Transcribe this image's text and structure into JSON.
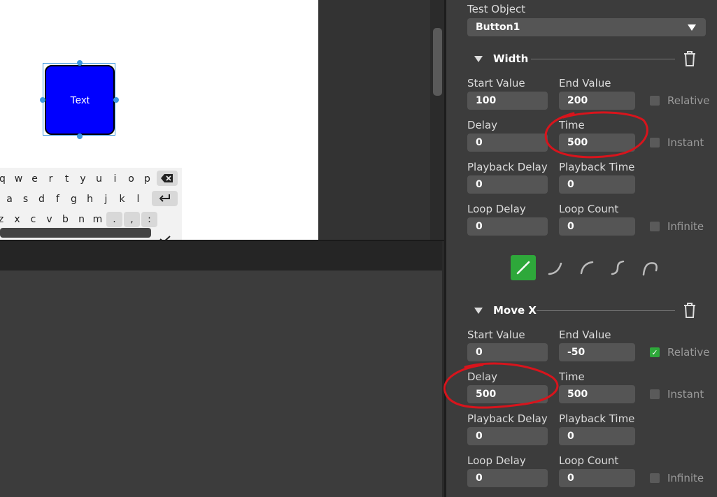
{
  "canvas": {
    "button_text": "Text",
    "keyboard": {
      "row1": [
        "q",
        "w",
        "e",
        "r",
        "t",
        "y",
        "u",
        "i",
        "o",
        "p"
      ],
      "row2": [
        "a",
        "s",
        "d",
        "f",
        "g",
        "h",
        "j",
        "k",
        "l"
      ],
      "row3": [
        "z",
        "x",
        "c",
        "v",
        "b",
        "n",
        "m",
        ".",
        ",",
        ":"
      ]
    }
  },
  "panel": {
    "test_object_label": "Test Object",
    "test_object_value": "Button1",
    "sections": [
      {
        "title": "Width",
        "start_value_label": "Start Value",
        "start_value": "100",
        "end_value_label": "End Value",
        "end_value": "200",
        "relative_label": "Relative",
        "relative_checked": false,
        "delay_label": "Delay",
        "delay": "0",
        "time_label": "Time",
        "time": "500",
        "instant_label": "Instant",
        "instant_checked": false,
        "playback_delay_label": "Playback Delay",
        "playback_delay": "0",
        "playback_time_label": "Playback Time",
        "playback_time": "0",
        "loop_delay_label": "Loop Delay",
        "loop_delay": "0",
        "loop_count_label": "Loop Count",
        "loop_count": "0",
        "infinite_label": "Infinite",
        "infinite_checked": false
      },
      {
        "title": "Move X",
        "start_value_label": "Start Value",
        "start_value": "0",
        "end_value_label": "End Value",
        "end_value": "-50",
        "relative_label": "Relative",
        "relative_checked": true,
        "delay_label": "Delay",
        "delay": "500",
        "time_label": "Time",
        "time": "500",
        "instant_label": "Instant",
        "instant_checked": false,
        "playback_delay_label": "Playback Delay",
        "playback_delay": "0",
        "playback_time_label": "Playback Time",
        "playback_time": "0",
        "loop_delay_label": "Loop Delay",
        "loop_delay": "0",
        "loop_count_label": "Loop Count",
        "loop_count": "0",
        "infinite_label": "Infinite",
        "infinite_checked": false
      }
    ],
    "easing_options": [
      "linear-easing-icon",
      "ease-in-icon",
      "ease-out-icon",
      "ease-in-out-icon",
      "ease-back-icon"
    ],
    "easing_selected": "linear-easing-icon"
  },
  "colors": {
    "accent_green": "#2ea83a",
    "button_blue": "#0000ff",
    "selection_blue": "#3b97e0",
    "annotation_red": "#d8141c"
  }
}
